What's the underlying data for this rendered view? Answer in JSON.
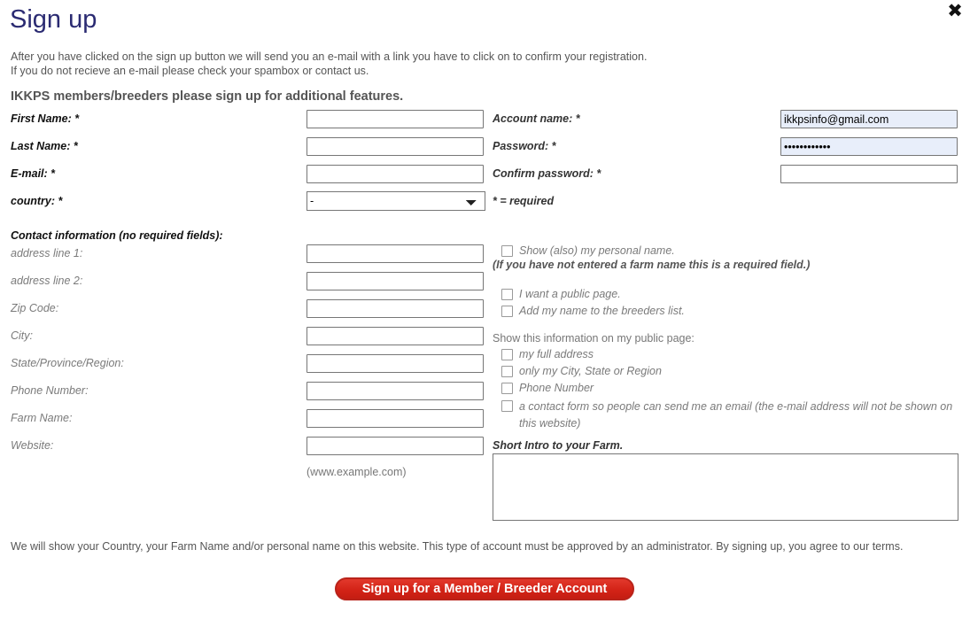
{
  "header": {
    "title": "Sign up",
    "close_icon": "close-icon",
    "intro_line1": "After you have clicked on the sign up button we will send you an e-mail with a link you have to click on to confirm your registration.",
    "intro_line2": "If you do not recieve an e-mail please check your spambox or contact us.",
    "section_heading": "IKKPS members/breeders please sign up for additional features."
  },
  "account_fields": {
    "first_name": {
      "label": "First Name: *",
      "value": "",
      "placeholder": ""
    },
    "last_name": {
      "label": "Last Name: *",
      "value": "",
      "placeholder": ""
    },
    "email": {
      "label": "E-mail: *",
      "value": "",
      "placeholder": ""
    },
    "country": {
      "label": "country: *",
      "selected": "-",
      "options": [
        "-"
      ]
    },
    "account_name": {
      "label": "Account name: *",
      "value": "ikkpsinfo@gmail.com",
      "placeholder": ""
    },
    "password": {
      "label": "Password: *",
      "value": "passwordpass",
      "placeholder": ""
    },
    "confirm_password": {
      "label": "Confirm password: *",
      "value": "",
      "placeholder": ""
    },
    "required_note": "* = required"
  },
  "contact": {
    "heading": "Contact information (no required fields):",
    "address_line_1": {
      "label": "address line 1:",
      "value": ""
    },
    "address_line_2": {
      "label": "address line 2:",
      "value": ""
    },
    "zip_code": {
      "label": "Zip Code:",
      "value": ""
    },
    "city": {
      "label": "City:",
      "value": ""
    },
    "state": {
      "label": "State/Province/Region:",
      "value": ""
    },
    "phone": {
      "label": "Phone Number:",
      "value": ""
    },
    "farm_name": {
      "label": "Farm Name:",
      "value": ""
    },
    "website": {
      "label": "Website:",
      "value": ""
    },
    "website_hint": "(www.example.com)"
  },
  "options": {
    "show_personal_name": "Show (also) my personal name.",
    "show_personal_name_note": "(If you have not entered a farm name this is a required field.)",
    "want_public_page": "I want a public page.",
    "add_to_breeders_list": "Add my name to the breeders list.",
    "public_info_heading": "Show this information on my public page:",
    "full_address": "my full address",
    "city_state_region": "only my City, State or Region",
    "phone_number": "Phone Number",
    "contact_form": "a contact form so people can send me an email (the e-mail address will not be shown on this website)"
  },
  "intro_farm": {
    "label": "Short Intro to your Farm.",
    "value": ""
  },
  "footer": {
    "disclaimer": "We will show your Country, your Farm Name and/or personal name on this website. This type of account must be approved by an administrator. By signing up, you agree to our terms.",
    "submit_label": "Sign up for a Member / Breeder Account"
  },
  "colors": {
    "title": "#2b2b72",
    "button_red": "#d32317",
    "autofill_blue": "#e8eefa",
    "body_text": "#555555"
  }
}
